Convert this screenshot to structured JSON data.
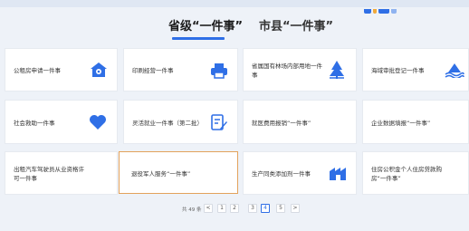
{
  "tabs": [
    {
      "label": "省级“一件事”"
    },
    {
      "label": "市县“一件事”"
    }
  ],
  "cards": [
    {
      "label_lines": [
        "公租房申请一件事"
      ],
      "icon": "house-gear-icon"
    },
    {
      "label_lines": [
        "印刷经营一件事"
      ],
      "icon": "printer-icon"
    },
    {
      "label_lines": [
        "省属国有林场内部用地一件",
        "事"
      ],
      "icon": "forest-trees-icon"
    },
    {
      "label_lines": [
        "海域审批登记一件事"
      ],
      "icon": "sea-island-icon"
    },
    {
      "label_lines": [
        "社会救助一件事"
      ],
      "icon": "heart-hands-icon"
    },
    {
      "label_lines": [
        "灵活就业一件事（第二批）"
      ],
      "icon": "document-pen-icon"
    },
    {
      "label_lines": [
        "就医费用报销“一件事”"
      ],
      "icon": ""
    },
    {
      "label_lines": [
        "企业数据填报“一件事”"
      ],
      "icon": ""
    },
    {
      "label_lines": [
        "出租汽车驾驶员从业资格许",
        "可一件事"
      ],
      "icon": ""
    },
    {
      "label_lines": [
        "退役军人服务“一件事”"
      ],
      "icon": ""
    },
    {
      "label_lines": [
        "生产同类添加剂一件事"
      ],
      "icon": "factory-icon"
    },
    {
      "label_lines": [
        "住房公积金个人住房贷款购",
        "房“一件事”"
      ],
      "icon": ""
    }
  ],
  "pagination": {
    "total": "共 49 条",
    "prev": "<",
    "pages": [
      "1",
      "2",
      "3",
      "4",
      "5"
    ],
    "current": "4",
    "next": ">"
  },
  "colors": {
    "accent": "#2f6fe6",
    "selected_border": "#e3a25c",
    "icon_blue": "#2f6fe6"
  }
}
